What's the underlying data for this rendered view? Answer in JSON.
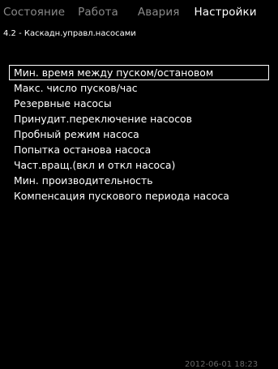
{
  "tabs": [
    {
      "label": "Состояние",
      "active": false
    },
    {
      "label": "Работа",
      "active": false
    },
    {
      "label": "Авария",
      "active": false
    },
    {
      "label": "Настройки",
      "active": true
    }
  ],
  "breadcrumb": "4.2 - Каскадн.управл.насосами",
  "menu": {
    "items": [
      "Мин. время между пуском/остановом",
      "Макс. число пусков/час",
      "Резервные насосы",
      "Принудит.переключение насосов",
      "Пробный режим насоса",
      "Попытка останова насоса",
      "Част.вращ.(вкл и откл насоса)",
      "Мин. производительность",
      "Компенсация пускового периода насоса"
    ],
    "selected_index": 0
  },
  "footer": {
    "datetime": "2012-06-01 18:23"
  },
  "colors": {
    "background": "#000000",
    "text": "#ffffff",
    "inactive_tab": "#8a8a8a"
  }
}
